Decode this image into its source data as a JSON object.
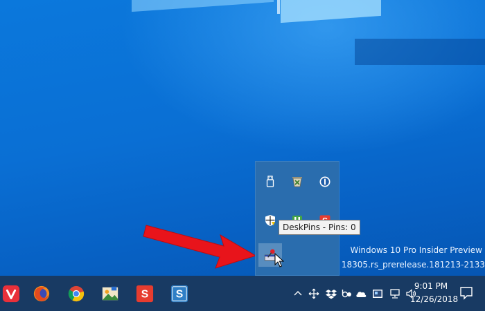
{
  "watermark": {
    "line1": "Windows 10 Pro Insider Preview",
    "line2": "y. Build 18305.rs_prerelease.181213-2133"
  },
  "tray_popup": {
    "icons": [
      "usb-icon",
      "recycle-sort-icon",
      "onepassword-icon",
      "shield-icon",
      "green-app-icon",
      "snagit-icon",
      "deskpins-icon"
    ]
  },
  "tooltip": {
    "text": "DeskPins - Pins: 0"
  },
  "taskbar": {
    "apps": [
      "vivaldi-icon",
      "firefox-icon",
      "chrome-icon",
      "photos-icon",
      "snagit-icon",
      "snagit-editor-icon"
    ],
    "clock": {
      "time": "9:01 PM",
      "date": "12/26/2018"
    }
  },
  "colors": {
    "desktop": "#0a6cd0",
    "taskbar": "#183a63",
    "arrow": "#e8141b",
    "tray_popup": "#2a6dae"
  }
}
